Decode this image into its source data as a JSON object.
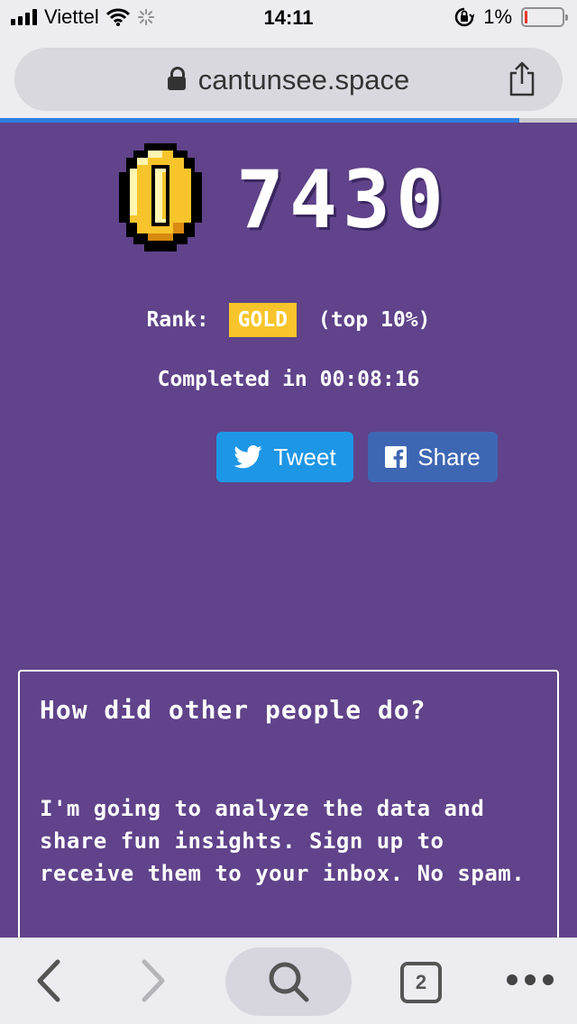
{
  "status_bar": {
    "carrier": "Viettel",
    "time": "14:11",
    "battery_percent": "1%",
    "battery_level": 0.01,
    "battery_color": "#e5372d"
  },
  "browser": {
    "url": "cantunsee.space",
    "load_progress": 0.9,
    "progress_color": "#2f7de1",
    "tab_count": "2"
  },
  "result": {
    "score": "7430",
    "rank_label": "Rank:",
    "rank": "GOLD",
    "rank_note": "(top 10%)",
    "completed_label": "Completed in",
    "completed_time": "00:08:16"
  },
  "social": {
    "tweet_label": "Tweet",
    "share_label": "Share",
    "tweet_color": "#1d96e5",
    "share_color": "#3e67b3"
  },
  "card": {
    "title": "How did other people do?",
    "body": "I'm going to analyze the data and share fun insights. Sign up to receive them to your inbox. No spam."
  },
  "colors": {
    "background": "#60438a",
    "gold": "#f7c52b"
  }
}
